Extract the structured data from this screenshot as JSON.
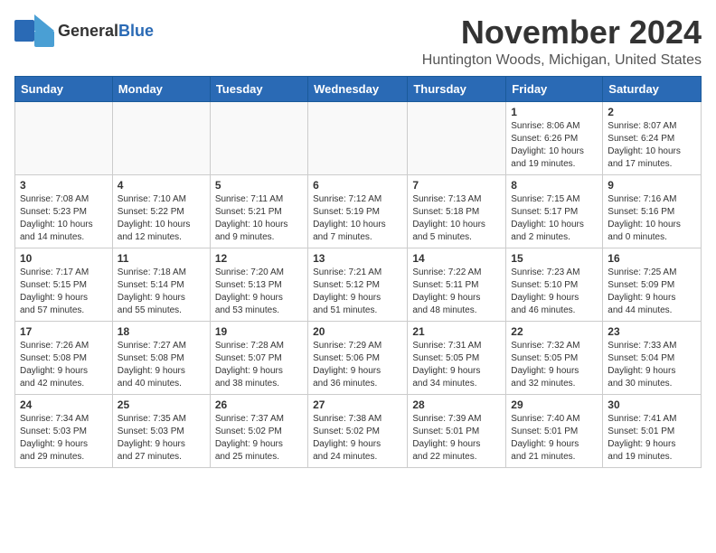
{
  "header": {
    "logo_general": "General",
    "logo_blue": "Blue",
    "month_title": "November 2024",
    "location": "Huntington Woods, Michigan, United States"
  },
  "calendar": {
    "days_of_week": [
      "Sunday",
      "Monday",
      "Tuesday",
      "Wednesday",
      "Thursday",
      "Friday",
      "Saturday"
    ],
    "weeks": [
      [
        {
          "day": "",
          "info": ""
        },
        {
          "day": "",
          "info": ""
        },
        {
          "day": "",
          "info": ""
        },
        {
          "day": "",
          "info": ""
        },
        {
          "day": "",
          "info": ""
        },
        {
          "day": "1",
          "info": "Sunrise: 8:06 AM\nSunset: 6:26 PM\nDaylight: 10 hours\nand 19 minutes."
        },
        {
          "day": "2",
          "info": "Sunrise: 8:07 AM\nSunset: 6:24 PM\nDaylight: 10 hours\nand 17 minutes."
        }
      ],
      [
        {
          "day": "3",
          "info": "Sunrise: 7:08 AM\nSunset: 5:23 PM\nDaylight: 10 hours\nand 14 minutes."
        },
        {
          "day": "4",
          "info": "Sunrise: 7:10 AM\nSunset: 5:22 PM\nDaylight: 10 hours\nand 12 minutes."
        },
        {
          "day": "5",
          "info": "Sunrise: 7:11 AM\nSunset: 5:21 PM\nDaylight: 10 hours\nand 9 minutes."
        },
        {
          "day": "6",
          "info": "Sunrise: 7:12 AM\nSunset: 5:19 PM\nDaylight: 10 hours\nand 7 minutes."
        },
        {
          "day": "7",
          "info": "Sunrise: 7:13 AM\nSunset: 5:18 PM\nDaylight: 10 hours\nand 5 minutes."
        },
        {
          "day": "8",
          "info": "Sunrise: 7:15 AM\nSunset: 5:17 PM\nDaylight: 10 hours\nand 2 minutes."
        },
        {
          "day": "9",
          "info": "Sunrise: 7:16 AM\nSunset: 5:16 PM\nDaylight: 10 hours\nand 0 minutes."
        }
      ],
      [
        {
          "day": "10",
          "info": "Sunrise: 7:17 AM\nSunset: 5:15 PM\nDaylight: 9 hours\nand 57 minutes."
        },
        {
          "day": "11",
          "info": "Sunrise: 7:18 AM\nSunset: 5:14 PM\nDaylight: 9 hours\nand 55 minutes."
        },
        {
          "day": "12",
          "info": "Sunrise: 7:20 AM\nSunset: 5:13 PM\nDaylight: 9 hours\nand 53 minutes."
        },
        {
          "day": "13",
          "info": "Sunrise: 7:21 AM\nSunset: 5:12 PM\nDaylight: 9 hours\nand 51 minutes."
        },
        {
          "day": "14",
          "info": "Sunrise: 7:22 AM\nSunset: 5:11 PM\nDaylight: 9 hours\nand 48 minutes."
        },
        {
          "day": "15",
          "info": "Sunrise: 7:23 AM\nSunset: 5:10 PM\nDaylight: 9 hours\nand 46 minutes."
        },
        {
          "day": "16",
          "info": "Sunrise: 7:25 AM\nSunset: 5:09 PM\nDaylight: 9 hours\nand 44 minutes."
        }
      ],
      [
        {
          "day": "17",
          "info": "Sunrise: 7:26 AM\nSunset: 5:08 PM\nDaylight: 9 hours\nand 42 minutes."
        },
        {
          "day": "18",
          "info": "Sunrise: 7:27 AM\nSunset: 5:08 PM\nDaylight: 9 hours\nand 40 minutes."
        },
        {
          "day": "19",
          "info": "Sunrise: 7:28 AM\nSunset: 5:07 PM\nDaylight: 9 hours\nand 38 minutes."
        },
        {
          "day": "20",
          "info": "Sunrise: 7:29 AM\nSunset: 5:06 PM\nDaylight: 9 hours\nand 36 minutes."
        },
        {
          "day": "21",
          "info": "Sunrise: 7:31 AM\nSunset: 5:05 PM\nDaylight: 9 hours\nand 34 minutes."
        },
        {
          "day": "22",
          "info": "Sunrise: 7:32 AM\nSunset: 5:05 PM\nDaylight: 9 hours\nand 32 minutes."
        },
        {
          "day": "23",
          "info": "Sunrise: 7:33 AM\nSunset: 5:04 PM\nDaylight: 9 hours\nand 30 minutes."
        }
      ],
      [
        {
          "day": "24",
          "info": "Sunrise: 7:34 AM\nSunset: 5:03 PM\nDaylight: 9 hours\nand 29 minutes."
        },
        {
          "day": "25",
          "info": "Sunrise: 7:35 AM\nSunset: 5:03 PM\nDaylight: 9 hours\nand 27 minutes."
        },
        {
          "day": "26",
          "info": "Sunrise: 7:37 AM\nSunset: 5:02 PM\nDaylight: 9 hours\nand 25 minutes."
        },
        {
          "day": "27",
          "info": "Sunrise: 7:38 AM\nSunset: 5:02 PM\nDaylight: 9 hours\nand 24 minutes."
        },
        {
          "day": "28",
          "info": "Sunrise: 7:39 AM\nSunset: 5:01 PM\nDaylight: 9 hours\nand 22 minutes."
        },
        {
          "day": "29",
          "info": "Sunrise: 7:40 AM\nSunset: 5:01 PM\nDaylight: 9 hours\nand 21 minutes."
        },
        {
          "day": "30",
          "info": "Sunrise: 7:41 AM\nSunset: 5:01 PM\nDaylight: 9 hours\nand 19 minutes."
        }
      ]
    ]
  }
}
